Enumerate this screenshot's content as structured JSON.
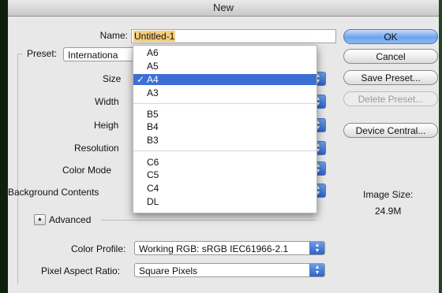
{
  "window": {
    "title": "New"
  },
  "form": {
    "name_label": "Name:",
    "name_value": "Untitled-1",
    "preset_label": "Preset:",
    "preset_value": "Internationa",
    "size_label": "Size",
    "width_label": "Width",
    "height_label": "Heigh",
    "resolution_label": "Resolution",
    "color_mode_label": "Color Mode",
    "background_label": "Background Contents",
    "advanced_label": "Advanced",
    "color_profile_label": "Color Profile:",
    "color_profile_value": "Working RGB:  sRGB IEC61966-2.1",
    "pixel_aspect_label": "Pixel Aspect Ratio:",
    "pixel_aspect_value": "Square Pixels"
  },
  "buttons": {
    "ok": "OK",
    "cancel": "Cancel",
    "save_preset": "Save Preset...",
    "delete_preset": "Delete Preset...",
    "device_central": "Device Central..."
  },
  "image_size": {
    "label": "Image Size:",
    "value": "24.9M"
  },
  "size_menu": {
    "items": [
      "A6",
      "A5",
      "A4",
      "A3",
      "B5",
      "B4",
      "B3",
      "C6",
      "C5",
      "C4",
      "DL"
    ],
    "selected": "A4",
    "check_mark": "✓"
  },
  "colors": {
    "selection": "#3d6ed5",
    "name_highlight": "#f6ce7a",
    "ok_button": "#6fa3ea"
  }
}
